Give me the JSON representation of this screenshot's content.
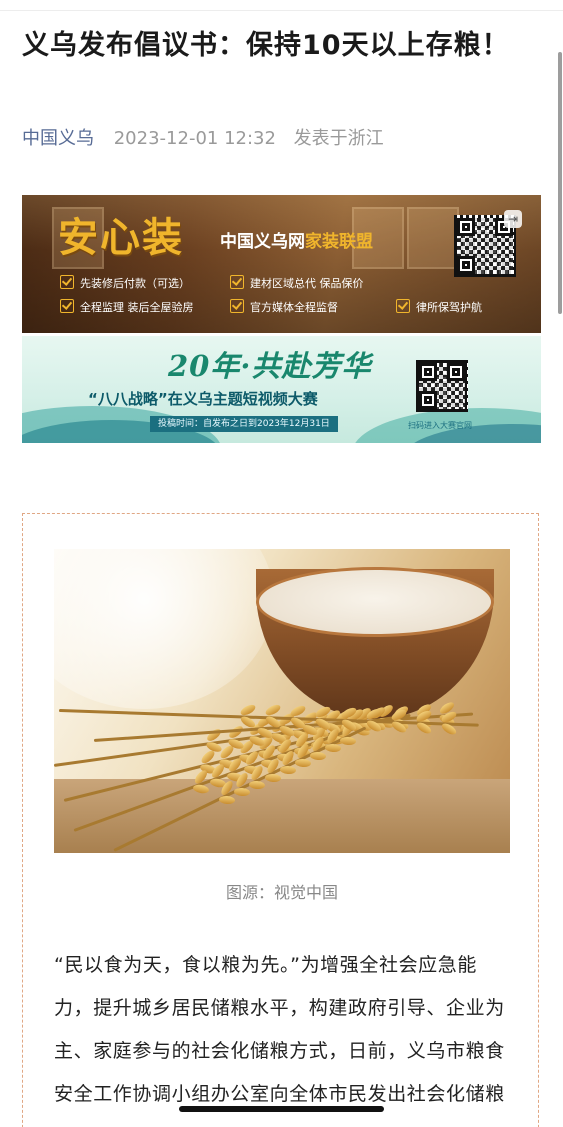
{
  "article": {
    "title": "义乌发布倡议书：保持10天以上存粮！",
    "source": "中国义乌",
    "datetime": "2023-12-01 12:32",
    "location": "发表于浙江"
  },
  "banner_home": {
    "brand": "安心装",
    "subtitle_prefix": "中国义乌网",
    "subtitle_highlight": "家装联盟",
    "features": [
      "先装修后付款（可选）",
      "建材区域总代 保品保价",
      "全程监理 装后全屋验房",
      "官方媒体全程监督",
      "律所保驾护航"
    ],
    "icon": "exit-icon"
  },
  "banner_contest": {
    "headline": "20年·共赴芳华",
    "theme": "“八八战略”在义乌主题短视频大赛",
    "deadline": "投稿时间：自发布之日到2023年12月31日",
    "qr_label": "扫码进入大赛官网"
  },
  "figure": {
    "caption": "图源：视觉中国"
  },
  "body": {
    "paragraph": "“民以食为天，食以粮为先。”为增强全社会应急能力，提升城乡居民储粮水平，构建政府引导、企业为主、家庭参与的社会化储粮方式，日前，义乌市粮食安全工作协调小组办公室向全体市民发出社会化储粮倡议"
  },
  "colors": {
    "source_link": "#576b95",
    "brand_gold": "#f0b52c",
    "contest_green": "#19876d",
    "frame_border": "#e0a784"
  }
}
